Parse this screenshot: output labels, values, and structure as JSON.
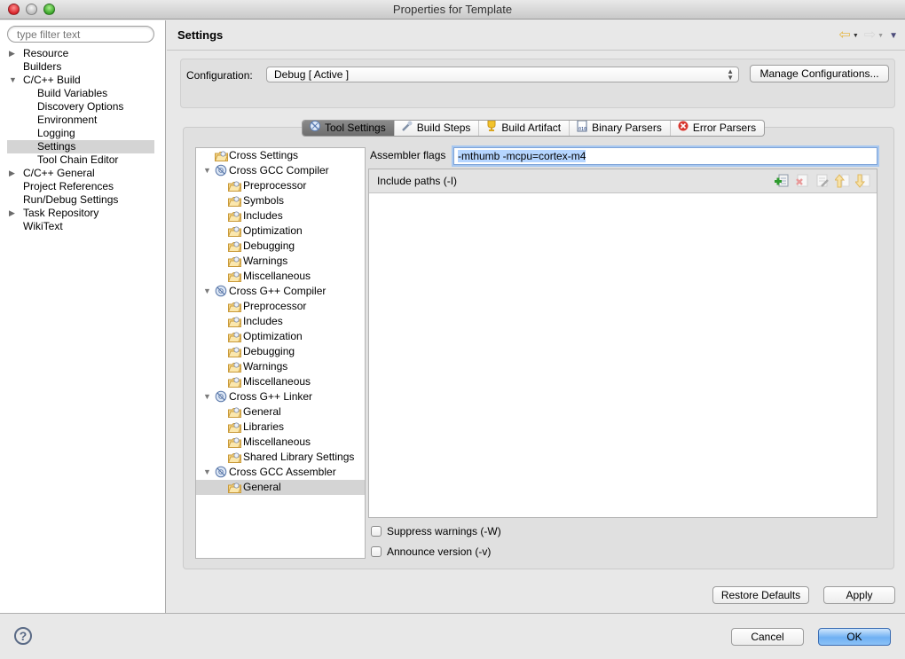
{
  "window": {
    "title": "Properties for Template"
  },
  "sidebar": {
    "filter_placeholder": "type filter text",
    "items": [
      {
        "label": "Resource",
        "level": 0,
        "twisty": "collapsed"
      },
      {
        "label": "Builders",
        "level": 0,
        "twisty": "none"
      },
      {
        "label": "C/C++ Build",
        "level": 0,
        "twisty": "expanded"
      },
      {
        "label": "Build Variables",
        "level": 1,
        "twisty": "none"
      },
      {
        "label": "Discovery Options",
        "level": 1,
        "twisty": "none"
      },
      {
        "label": "Environment",
        "level": 1,
        "twisty": "none"
      },
      {
        "label": "Logging",
        "level": 1,
        "twisty": "none"
      },
      {
        "label": "Settings",
        "level": 1,
        "twisty": "none",
        "selected": true
      },
      {
        "label": "Tool Chain Editor",
        "level": 1,
        "twisty": "none"
      },
      {
        "label": "C/C++ General",
        "level": 0,
        "twisty": "collapsed"
      },
      {
        "label": "Project References",
        "level": 0,
        "twisty": "none"
      },
      {
        "label": "Run/Debug Settings",
        "level": 0,
        "twisty": "none"
      },
      {
        "label": "Task Repository",
        "level": 0,
        "twisty": "collapsed"
      },
      {
        "label": "WikiText",
        "level": 0,
        "twisty": "none"
      }
    ]
  },
  "header": {
    "title": "Settings",
    "back_icon": "back-arrow-icon",
    "forward_icon": "forward-arrow-icon",
    "menu_icon": "view-menu-icon"
  },
  "configuration": {
    "label": "Configuration:",
    "selected": "Debug  [ Active ]",
    "manage_button": "Manage Configurations..."
  },
  "tabs": [
    {
      "label": "Tool Settings",
      "icon": "tool-settings-icon",
      "active": true
    },
    {
      "label": "Build Steps",
      "icon": "build-steps-icon"
    },
    {
      "label": "Build Artifact",
      "icon": "build-artifact-icon"
    },
    {
      "label": "Binary Parsers",
      "icon": "binary-parsers-icon"
    },
    {
      "label": "Error Parsers",
      "icon": "error-parsers-icon"
    }
  ],
  "tool_tree": [
    {
      "label": "Cross Settings",
      "type": "option",
      "level": 0
    },
    {
      "label": "Cross GCC Compiler",
      "type": "tool",
      "level": 0
    },
    {
      "label": "Preprocessor",
      "type": "option",
      "level": 1
    },
    {
      "label": "Symbols",
      "type": "option",
      "level": 1
    },
    {
      "label": "Includes",
      "type": "option",
      "level": 1
    },
    {
      "label": "Optimization",
      "type": "option",
      "level": 1
    },
    {
      "label": "Debugging",
      "type": "option",
      "level": 1
    },
    {
      "label": "Warnings",
      "type": "option",
      "level": 1
    },
    {
      "label": "Miscellaneous",
      "type": "option",
      "level": 1
    },
    {
      "label": "Cross G++ Compiler",
      "type": "tool",
      "level": 0
    },
    {
      "label": "Preprocessor",
      "type": "option",
      "level": 1
    },
    {
      "label": "Includes",
      "type": "option",
      "level": 1
    },
    {
      "label": "Optimization",
      "type": "option",
      "level": 1
    },
    {
      "label": "Debugging",
      "type": "option",
      "level": 1
    },
    {
      "label": "Warnings",
      "type": "option",
      "level": 1
    },
    {
      "label": "Miscellaneous",
      "type": "option",
      "level": 1
    },
    {
      "label": "Cross G++ Linker",
      "type": "tool",
      "level": 0
    },
    {
      "label": "General",
      "type": "option",
      "level": 1
    },
    {
      "label": "Libraries",
      "type": "option",
      "level": 1
    },
    {
      "label": "Miscellaneous",
      "type": "option",
      "level": 1
    },
    {
      "label": "Shared Library Settings",
      "type": "option",
      "level": 1
    },
    {
      "label": "Cross GCC Assembler",
      "type": "tool",
      "level": 0
    },
    {
      "label": "General",
      "type": "option",
      "level": 1,
      "selected": true
    }
  ],
  "assembler": {
    "flags_label": "Assembler flags",
    "flags_value": "-mthumb -mcpu=cortex-m4",
    "include_paths_label": "Include paths (-I)",
    "include_paths": [],
    "path_tools": [
      {
        "name": "add-path-icon",
        "enabled": true
      },
      {
        "name": "delete-path-icon",
        "enabled": false
      },
      {
        "name": "edit-path-icon",
        "enabled": false
      },
      {
        "name": "move-up-icon",
        "enabled": false
      },
      {
        "name": "move-down-icon",
        "enabled": false
      }
    ],
    "suppress_warnings": {
      "label": "Suppress warnings (-W)",
      "checked": false
    },
    "announce_version": {
      "label": "Announce version (-v)",
      "checked": false
    }
  },
  "buttons": {
    "restore_defaults": "Restore Defaults",
    "apply": "Apply",
    "cancel": "Cancel",
    "ok": "OK"
  },
  "help": {
    "glyph": "?"
  }
}
